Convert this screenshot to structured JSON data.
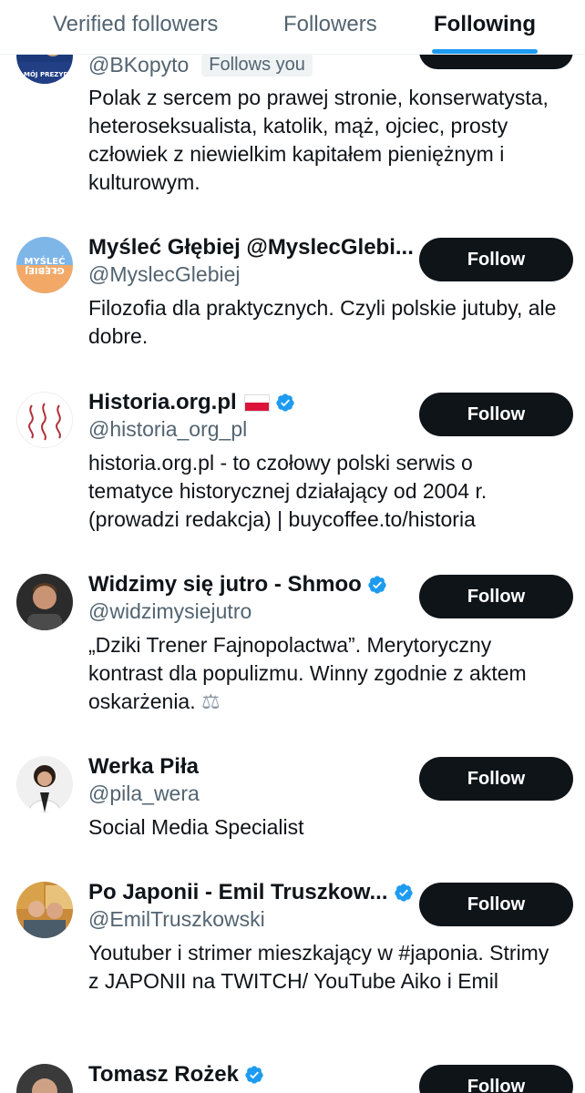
{
  "tabs": [
    {
      "label": "Verified followers",
      "active": false
    },
    {
      "label": "Followers",
      "active": false
    },
    {
      "label": "Following",
      "active": true
    }
  ],
  "accounts": [
    {
      "name": "",
      "handle": "@BKopyto",
      "badge": "Follows you",
      "bio": "Polak z sercem po prawej stronie, konserwatysta, heteroseksualista, katolik, mąż, ojciec, prosty człowiek z niewielkim kapitałem pieniężnym i kulturowym.",
      "avatar_text": "MÓJ PREZYDENT",
      "button": ""
    },
    {
      "name": "Myśleć Głębiej @MyslecGlebi...",
      "handle": "@MyslecGlebiej",
      "bio": "Filozofia dla praktycznych. Czyli polskie jutuby, ale dobre.",
      "avatar_text": "MYŚLEĆ GŁĘBIEJ",
      "button": "Follow"
    },
    {
      "name": "Historia.org.pl",
      "handle": "@historia_org_pl",
      "bio": "historia.org.pl - to czołowy polski serwis o tematyce historycznej działający od 2004 r. (prowadzi redakcja) | buycoffee.to/historia",
      "button": "Follow"
    },
    {
      "name": "Widzimy się jutro - Shmoo",
      "handle": "@widzimysiejutro",
      "bio": "„Dziki Trener Fajnopolactwa”. Merytoryczny kontrast dla populizmu. Winny zgodnie z aktem oskarżenia.",
      "bio_emoji": "⚖",
      "button": "Follow"
    },
    {
      "name": "Werka Piła",
      "handle": "@pila_wera",
      "bio": "Social Media Specialist",
      "button": "Follow"
    },
    {
      "name": "Po Japonii - Emil Truszkow...",
      "handle": "@EmilTruszkowski",
      "bio": "Youtuber i strimer mieszkający w #japonia. Strimy z JAPONII na TWITCH/ YouTube Aiko i Emil",
      "button": "Follow"
    },
    {
      "name": "Tomasz Rożek",
      "handle": "",
      "bio": "",
      "button": "Follow"
    }
  ],
  "colors": {
    "accent": "#1d9bf0",
    "button_bg": "#0f1419",
    "secondary_text": "#536471",
    "verified": "#1d9bf0"
  },
  "icons": {
    "verified": "verified-badge-icon",
    "flag": "poland-flag-icon"
  }
}
